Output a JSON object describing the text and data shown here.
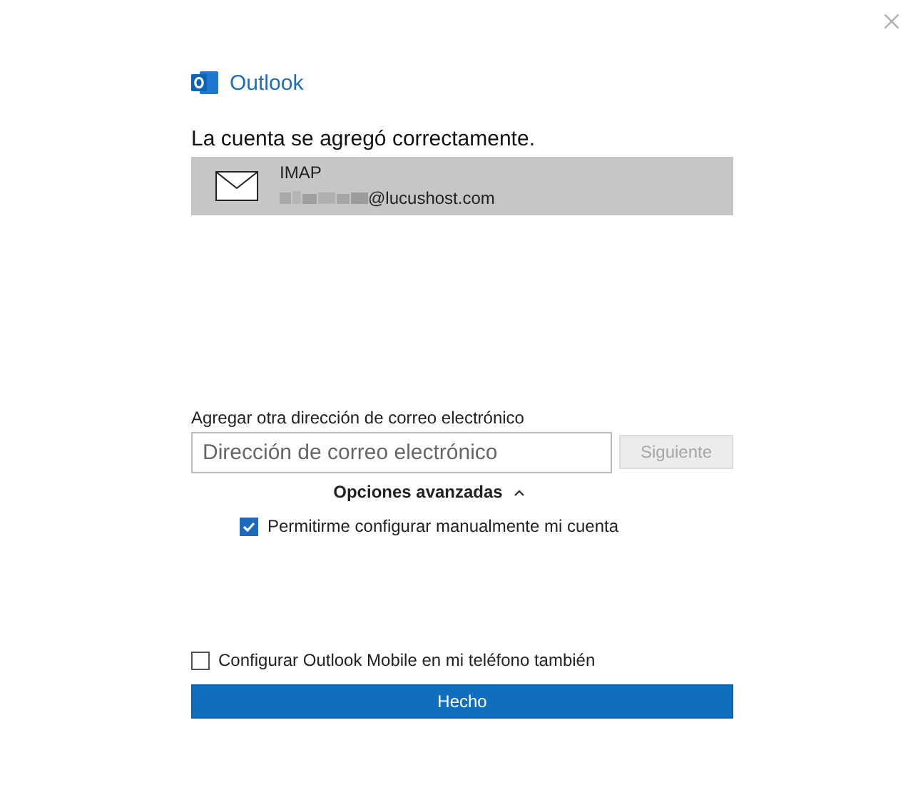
{
  "app_name": "Outlook",
  "heading": "La cuenta se agregó correctamente.",
  "account": {
    "type": "IMAP",
    "email": "@lucushost.com",
    "selected": true
  },
  "add_label": "Agregar otra dirección de correo electrónico",
  "email_field": {
    "placeholder": "Dirección de correo electrónico"
  },
  "next_button": {
    "label": "Siguiente",
    "disabled": true
  },
  "advanced": {
    "label": "Opciones avanzadas",
    "expanded": true
  },
  "manual_setup": {
    "label": "Permitirme configurar manualmente mi cuenta",
    "checked": true
  },
  "mobile_setup": {
    "label": "Configurar Outlook Mobile en mi teléfono también",
    "checked": false
  },
  "done_button": {
    "label": "Hecho"
  }
}
